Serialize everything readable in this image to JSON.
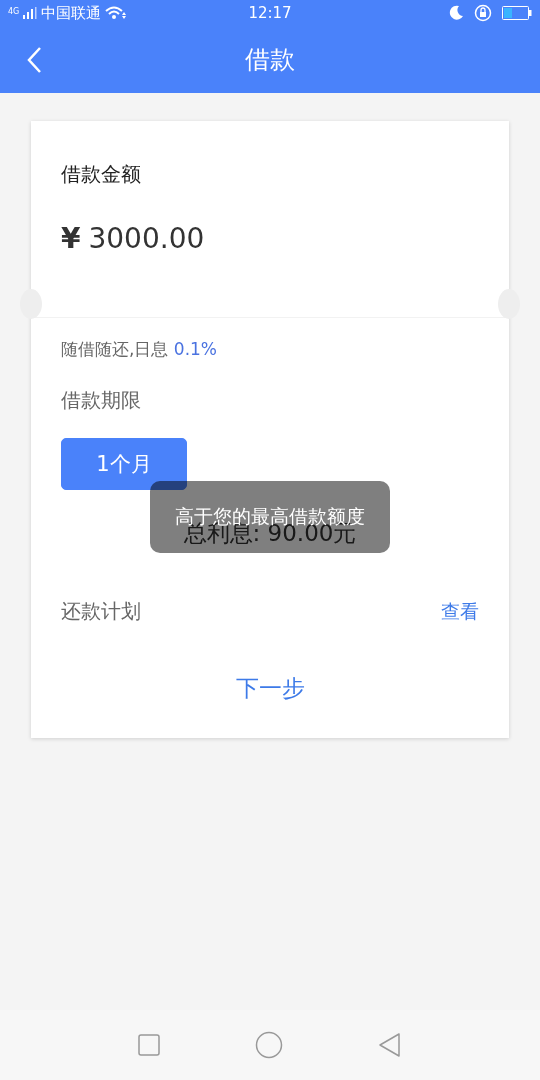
{
  "status_bar": {
    "network": "4G",
    "carrier": "中国联通",
    "time": "12:17"
  },
  "header": {
    "title": "借款"
  },
  "loan_card": {
    "amount_label": "借款金额",
    "currency": "¥",
    "amount": "3000.00",
    "rate_text": "随借随还,日息 ",
    "rate_value": "0.1%",
    "term_label": "借款期限",
    "terms": [
      {
        "label": "1个月",
        "selected": true
      }
    ],
    "interest": "总利息: 90.00元",
    "plan_label": "还款计划",
    "plan_link": "查看",
    "next_button": "下一步"
  },
  "toast": "高于您的最高借款额度"
}
